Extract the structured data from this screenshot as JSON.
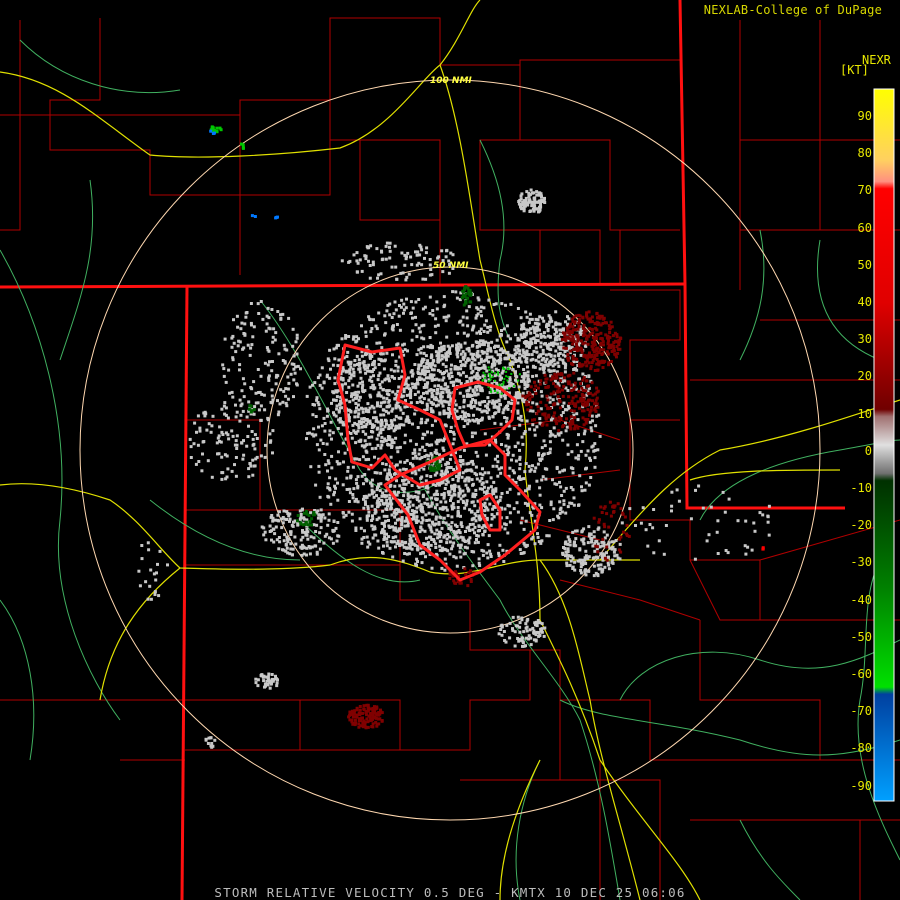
{
  "header": {
    "credit": "NEXLAB-College of DuPage",
    "product_code": "NEXR",
    "units": "[KT]"
  },
  "footer": {
    "status": "STORM RELATIVE VELOCITY 0.5 DEG - KMTX 10 DEC 25 06:06"
  },
  "range_rings": [
    {
      "label": "50 NMI"
    },
    {
      "label": "100 NMI"
    }
  ],
  "color_scale": {
    "ticks": [
      "90",
      "80",
      "70",
      "60",
      "50",
      "40",
      "30",
      "20",
      "10",
      "0",
      "-10",
      "-20",
      "-30",
      "-40",
      "-50",
      "-60",
      "-70",
      "-80",
      "-90"
    ],
    "colors": {
      "outbound_high": "#ff0000",
      "outbound_dark": "#800000",
      "near_zero": "#c8c8c8",
      "inbound": "#00c800",
      "inbound_dark": "#006000",
      "inbound_high": "#0078ff"
    }
  },
  "map_colors": {
    "state_border": "#ff0000",
    "county_border": "#c00000",
    "highway": "#e8e800",
    "river": "#50c878",
    "warning_polygon": "#ff2020",
    "range_ring": "#ffd0a0"
  }
}
